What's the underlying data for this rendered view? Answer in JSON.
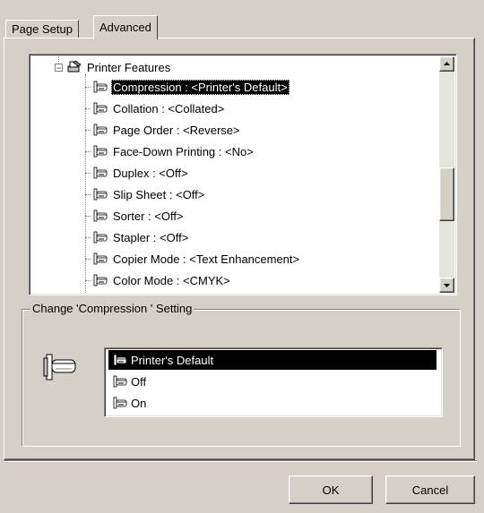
{
  "tabs": [
    {
      "label": "Page Setup"
    },
    {
      "label": "Advanced"
    }
  ],
  "tree": {
    "parent_label": "Printer Features",
    "items": [
      {
        "label": "Compression : <Printer's Default>",
        "selected": true
      },
      {
        "label": "Collation : <Collated>"
      },
      {
        "label": "Page Order : <Reverse>"
      },
      {
        "label": "Face-Down Printing : <No>"
      },
      {
        "label": "Duplex : <Off>"
      },
      {
        "label": "Slip Sheet : <Off>"
      },
      {
        "label": "Sorter : <Off>"
      },
      {
        "label": "Stapler : <Off>"
      },
      {
        "label": "Copier Mode : <Text Enhancement>"
      },
      {
        "label": "Color Mode : <CMYK>"
      }
    ]
  },
  "setting_group": {
    "title": "Change 'Compression ' Setting",
    "options": [
      {
        "label": "Printer's Default",
        "selected": true
      },
      {
        "label": "Off"
      },
      {
        "label": "On"
      }
    ]
  },
  "buttons": {
    "ok": "OK",
    "cancel": "Cancel"
  },
  "icons": {
    "expander": "minus-expander-icon",
    "printer_features": "printer-features-icon",
    "feature_item": "feature-item-icon"
  }
}
